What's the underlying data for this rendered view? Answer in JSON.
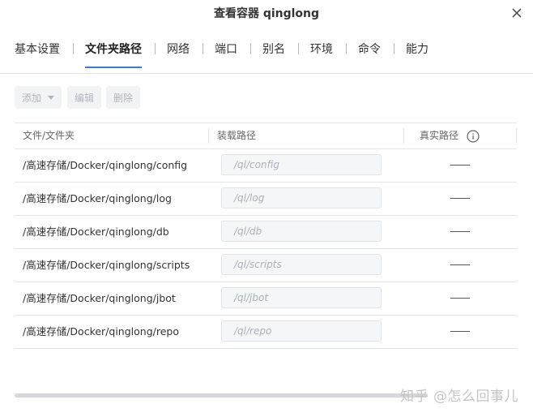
{
  "dialog": {
    "title": "查看容器 qinglong"
  },
  "icons": {
    "close": "close-icon",
    "info": "info-icon",
    "dropdown": "chevron-down-icon"
  },
  "tabs": [
    {
      "label": "基本设置",
      "active": false
    },
    {
      "label": "文件夹路径",
      "active": true
    },
    {
      "label": "网络",
      "active": false
    },
    {
      "label": "端口",
      "active": false
    },
    {
      "label": "别名",
      "active": false
    },
    {
      "label": "环境",
      "active": false
    },
    {
      "label": "命令",
      "active": false
    },
    {
      "label": "能力",
      "active": false
    }
  ],
  "toolbar": {
    "add_label": "添加",
    "edit_label": "编辑",
    "delete_label": "删除"
  },
  "table": {
    "columns": [
      "文件/文件夹",
      "装载路径",
      "真实路径"
    ],
    "rows": [
      {
        "path": "/高速存储/Docker/qinglong/config",
        "mount": "/ql/config",
        "real": "——"
      },
      {
        "path": "/高速存储/Docker/qinglong/log",
        "mount": "/ql/log",
        "real": "——"
      },
      {
        "path": "/高速存储/Docker/qinglong/db",
        "mount": "/ql/db",
        "real": "——"
      },
      {
        "path": "/高速存储/Docker/qinglong/scripts",
        "mount": "/ql/scripts",
        "real": "——"
      },
      {
        "path": "/高速存储/Docker/qinglong/jbot",
        "mount": "/ql/jbot",
        "real": "——"
      },
      {
        "path": "/高速存储/Docker/qinglong/repo",
        "mount": "/ql/repo",
        "real": "——"
      }
    ]
  },
  "watermark": "知乎 @怎么回事儿",
  "colors": {
    "tab_active_underline": "#3a7ad8",
    "disabled_text": "#b2b6bc"
  }
}
